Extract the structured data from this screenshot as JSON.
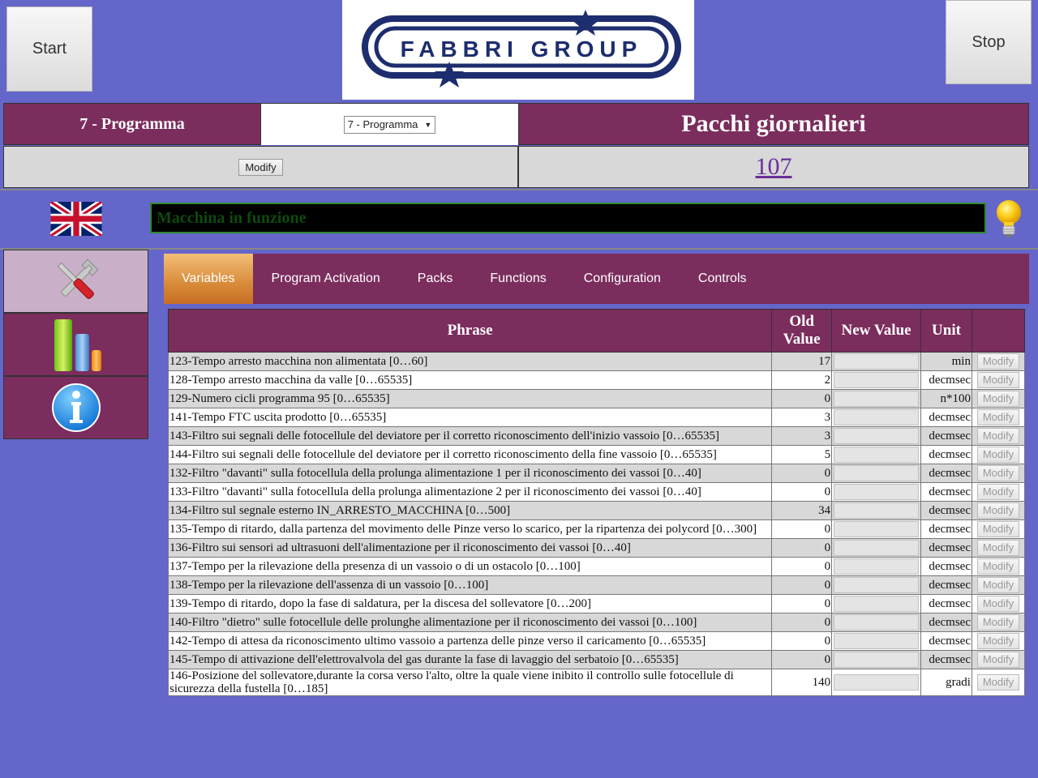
{
  "header": {
    "start_label": "Start",
    "stop_label": "Stop",
    "logo_text": "FABBRI GROUP"
  },
  "program": {
    "label": "7 - Programma",
    "selected": "7 - Programma",
    "modify_label": "Modify"
  },
  "counter": {
    "title": "Pacchi giornalieri",
    "value": "107"
  },
  "status": {
    "message": "Macchina in funzione"
  },
  "tabs": [
    "Variables",
    "Program Activation",
    "Packs",
    "Functions",
    "Configuration",
    "Controls"
  ],
  "table": {
    "headers": {
      "phrase": "Phrase",
      "old_value": "Old Value",
      "new_value": "New Value",
      "unit": "Unit"
    },
    "modify_label": "Modify",
    "rows": [
      {
        "phrase": "123-Tempo arresto macchina non alimentata [0…60]",
        "old": "17",
        "unit": "min"
      },
      {
        "phrase": "128-Tempo arresto macchina da valle [0…65535]",
        "old": "2",
        "unit": "decmsec"
      },
      {
        "phrase": "129-Numero cicli programma 95 [0…65535]",
        "old": "0",
        "unit": "n*100"
      },
      {
        "phrase": "141-Tempo FTC uscita prodotto [0…65535]",
        "old": "3",
        "unit": "decmsec"
      },
      {
        "phrase": "143-Filtro sui segnali delle fotocellule del deviatore per il corretto riconoscimento dell'inizio vassoio [0…65535]",
        "old": "3",
        "unit": "decmsec"
      },
      {
        "phrase": "144-Filtro sui segnali delle fotocellule del deviatore per il corretto riconoscimento della fine vassoio [0…65535]",
        "old": "5",
        "unit": "decmsec"
      },
      {
        "phrase": "132-Filtro \"davanti\" sulla fotocellula della prolunga alimentazione 1 per il riconoscimento dei vassoi [0…40]",
        "old": "0",
        "unit": "decmsec"
      },
      {
        "phrase": "133-Filtro \"davanti\" sulla fotocellula della prolunga alimentazione 2 per il riconoscimento dei vassoi [0…40]",
        "old": "0",
        "unit": "decmsec"
      },
      {
        "phrase": "134-Filtro sul segnale esterno IN_ARRESTO_MACCHINA [0…500]",
        "old": "34",
        "unit": "decmsec"
      },
      {
        "phrase": "135-Tempo di ritardo, dalla partenza del movimento delle Pinze verso lo scarico, per la ripartenza dei polycord [0…300]",
        "old": "0",
        "unit": "decmsec"
      },
      {
        "phrase": "136-Filtro sui sensori ad ultrasuoni dell'alimentazione per il riconoscimento dei vassoi [0…40]",
        "old": "0",
        "unit": "decmsec"
      },
      {
        "phrase": "137-Tempo per la rilevazione della presenza di un vassoio o di un ostacolo [0…100]",
        "old": "0",
        "unit": "decmsec"
      },
      {
        "phrase": "138-Tempo per la rilevazione dell'assenza di un vassoio [0…100]",
        "old": "0",
        "unit": "decmsec"
      },
      {
        "phrase": "139-Tempo di ritardo, dopo la fase di saldatura, per la discesa del sollevatore [0…200]",
        "old": "0",
        "unit": "decmsec"
      },
      {
        "phrase": "140-Filtro \"dietro\" sulle fotocellule delle prolunghe alimentazione per il riconoscimento dei vassoi [0…100]",
        "old": "0",
        "unit": "decmsec"
      },
      {
        "phrase": "142-Tempo di attesa da riconoscimento ultimo vassoio a partenza delle pinze verso il caricamento [0…65535]",
        "old": "0",
        "unit": "decmsec"
      },
      {
        "phrase": "145-Tempo di attivazione dell'elettrovalvola del gas durante la fase di lavaggio del serbatoio [0…65535]",
        "old": "0",
        "unit": "decmsec"
      },
      {
        "phrase": "146-Posizione del sollevatore,durante la corsa verso l'alto, oltre la quale viene inibito il controllo sulle fotocellule di sicurezza della fustella [0…185]",
        "old": "140",
        "unit": "gradi"
      }
    ]
  }
}
